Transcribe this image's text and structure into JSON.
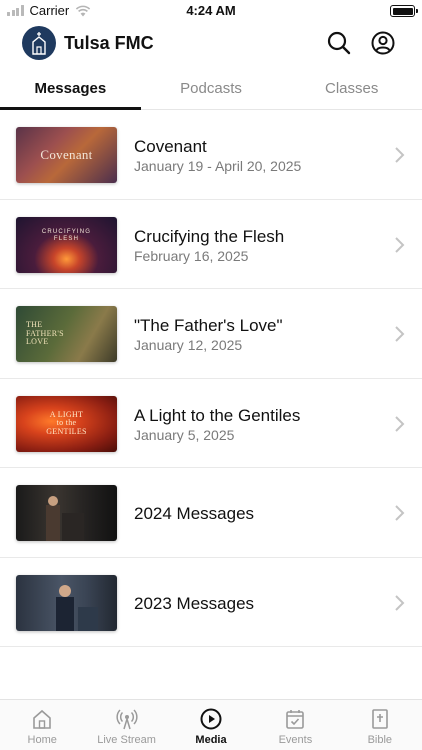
{
  "status_bar": {
    "carrier": "Carrier",
    "time": "4:24 AM"
  },
  "header": {
    "title": "Tulsa FMC",
    "logo_icon": "church-icon",
    "search_icon": "search-icon",
    "account_icon": "account-icon",
    "accent_color": "#1f3a5f"
  },
  "tabs": [
    {
      "label": "Messages",
      "active": true
    },
    {
      "label": "Podcasts",
      "active": false
    },
    {
      "label": "Classes",
      "active": false
    }
  ],
  "messages": [
    {
      "title": "Covenant",
      "subtitle": "January 19 - April 20, 2025",
      "thumb_text": "Covenant"
    },
    {
      "title": "Crucifying the Flesh",
      "subtitle": "February 16, 2025",
      "thumb_text": "CRUCIFYING\nFLESH"
    },
    {
      "title": "\"The Father's Love\"",
      "subtitle": "January 12, 2025",
      "thumb_text": "THE\nFATHER'S\nLOVE"
    },
    {
      "title": "A Light to the Gentiles",
      "subtitle": "January 5, 2025",
      "thumb_text": "A LIGHT\nto the\nGENTILES"
    },
    {
      "title": "2024 Messages",
      "subtitle": "",
      "thumb_text": ""
    },
    {
      "title": "2023 Messages",
      "subtitle": "",
      "thumb_text": ""
    }
  ],
  "bottom_nav": [
    {
      "label": "Home",
      "icon": "home-icon",
      "active": false
    },
    {
      "label": "Live Stream",
      "icon": "live-stream-icon",
      "active": false
    },
    {
      "label": "Media",
      "icon": "play-circle-icon",
      "active": true
    },
    {
      "label": "Events",
      "icon": "calendar-check-icon",
      "active": false
    },
    {
      "label": "Bible",
      "icon": "bible-icon",
      "active": false
    }
  ]
}
